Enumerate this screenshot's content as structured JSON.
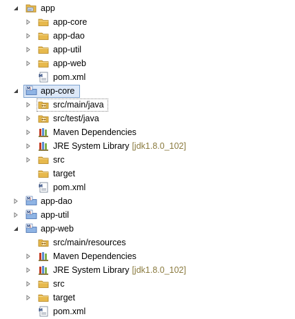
{
  "tree": [
    {
      "label": "app",
      "icon": "project-folder-icon",
      "expander": "expanded"
    },
    {
      "label": "app-core",
      "icon": "folder-icon",
      "expander": "collapsed"
    },
    {
      "label": "app-dao",
      "icon": "folder-icon",
      "expander": "collapsed"
    },
    {
      "label": "app-util",
      "icon": "folder-icon",
      "expander": "collapsed"
    },
    {
      "label": "app-web",
      "icon": "folder-icon",
      "expander": "collapsed"
    },
    {
      "label": "pom.xml",
      "icon": "maven-pom-icon",
      "expander": "none"
    },
    {
      "label": "app-core",
      "icon": "maven-project-icon",
      "expander": "expanded",
      "selected": true
    },
    {
      "label": "src/main/java",
      "icon": "source-folder-icon",
      "expander": "collapsed",
      "focused": true
    },
    {
      "label": "src/test/java",
      "icon": "source-folder-icon",
      "expander": "collapsed"
    },
    {
      "label": "Maven Dependencies",
      "icon": "library-icon",
      "expander": "collapsed"
    },
    {
      "label": "JRE System Library",
      "decoration": "[jdk1.8.0_102]",
      "icon": "library-icon",
      "expander": "collapsed"
    },
    {
      "label": "src",
      "icon": "folder-icon",
      "expander": "collapsed"
    },
    {
      "label": "target",
      "icon": "folder-icon",
      "expander": "none"
    },
    {
      "label": "pom.xml",
      "icon": "maven-pom-icon",
      "expander": "none"
    },
    {
      "label": "app-dao",
      "icon": "maven-project-icon",
      "expander": "collapsed"
    },
    {
      "label": "app-util",
      "icon": "maven-project-icon",
      "expander": "collapsed"
    },
    {
      "label": "app-web",
      "icon": "maven-project-icon",
      "expander": "expanded"
    },
    {
      "label": "src/main/resources",
      "icon": "source-folder-icon",
      "expander": "none"
    },
    {
      "label": "Maven Dependencies",
      "icon": "library-icon",
      "expander": "collapsed"
    },
    {
      "label": "JRE System Library",
      "decoration": "[jdk1.8.0_102]",
      "icon": "library-icon",
      "expander": "collapsed"
    },
    {
      "label": "src",
      "icon": "folder-icon",
      "expander": "collapsed"
    },
    {
      "label": "target",
      "icon": "folder-icon",
      "expander": "collapsed"
    },
    {
      "label": "pom.xml",
      "icon": "maven-pom-icon",
      "expander": "none"
    }
  ],
  "colors": {
    "folder": "#e7b94d",
    "library": "#5a8ad0",
    "selection": "#dce8f8",
    "decoration": "#8a7a3e"
  }
}
